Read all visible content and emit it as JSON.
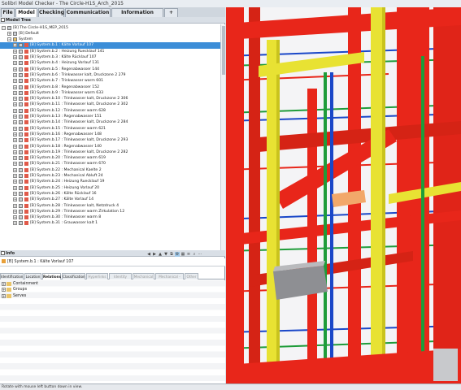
{
  "window": {
    "title": "Solibri Model Checker - The Circle-H1S_Arch_2015"
  },
  "menu": {
    "tabs": [
      {
        "label": "File"
      },
      {
        "label": "Model"
      },
      {
        "label": "Checking"
      },
      {
        "label": "Communication"
      },
      {
        "label": "Information Takeoff"
      },
      {
        "label": "+"
      }
    ],
    "active": "Model"
  },
  "model_tree": {
    "header": "Model Tree",
    "root": "[B] The Circle-H1S_MEP_2015",
    "default_node": "[B] Default",
    "system_node": "System",
    "items": [
      "[B] System.b.1 : Kälte Vorlauf 107",
      "[B] System.b.2 : Heizung Ruecklauf 141",
      "[B] System.b.3 : Kälte Rücklauf 107",
      "[B] System.b.4 : Heizung Vorlauf 131",
      "[B] System.b.5 : Regenabwasser 144",
      "[B] System.b.6 : Trinkwasser kalt, Druckzone 2 279",
      "[B] System.b.7 : Trinkwasser warm 601",
      "[B] System.b.8 : Regenabwasser 152",
      "[B] System.b.9 : Trinkwasser warm 633",
      "[B] System.b.10 : Trinkwasser kalt, Druckzone 2 306",
      "[B] System.b.11 : Trinkwasser kalt, Druckzone 2 302",
      "[B] System.b.12 : Trinkwasser warm 628",
      "[B] System.b.13 : Regenabwasser 151",
      "[B] System.b.14 : Trinkwasser kalt, Druckzone 2 284",
      "[B] System.b.15 : Trinkwasser warm 621",
      "[B] System.b.16 : Regenabwasser 148",
      "[B] System.b.17 : Trinkwasser kalt, Druckzone 2 293",
      "[B] System.b.18 : Regenabwasser 140",
      "[B] System.b.19 : Trinkwasser kalt, Druckzone 2 282",
      "[B] System.b.20 : Trinkwasser warm 619",
      "[B] System.b.21 : Trinkwasser warm 670",
      "[B] System.b.22 : Mechanical Kaelte 2",
      "[B] System.b.23 : Mechanical Abluft 24",
      "[B] System.b.24 : Heizung Ruecklauf 19",
      "[B] System.b.25 : Heizung Vorlauf 20",
      "[B] System.b.26 : Kälte Rücklauf 16",
      "[B] System.b.27 : Kälte Vorlauf 14",
      "[B] System.b.28 : Trinkwasser kalt, Netzdruck 4",
      "[B] System.b.29 : Trinkwasser warm Zirkulation 12",
      "[B] System.b.30 : Trinkwasser warm 8",
      "[B] System.b.31 : Grauwasser kalt 1"
    ],
    "selected_index": 0
  },
  "info": {
    "header": "Info",
    "selected_item": "[B] System.b.1 : Kälte Vorlauf 107",
    "tabs": [
      {
        "label": "Identification",
        "enabled": true
      },
      {
        "label": "Location",
        "enabled": true
      },
      {
        "label": "Relations",
        "enabled": true
      },
      {
        "label": "Classification",
        "enabled": true
      },
      {
        "label": "Hyperlinks",
        "enabled": false
      },
      {
        "label": "Identity Data",
        "enabled": false
      },
      {
        "label": "Mechanical",
        "enabled": false
      },
      {
        "label": "Mechanical - Flow",
        "enabled": false
      },
      {
        "label": "Other",
        "enabled": false
      }
    ],
    "active_tab": "Relations",
    "relations": [
      "Containment",
      "Groups",
      "Serves"
    ]
  },
  "status": {
    "text": "Rotate with mouse left button down in view."
  },
  "colors": {
    "selection": "#3c8ed8",
    "pipe_red": "#e8261a",
    "pipe_yellow": "#e8e233",
    "pipe_green": "#1f9c3a",
    "pipe_blue": "#1a47c8"
  },
  "icons": {
    "tree_item": "system-icon",
    "folder": "folder-icon",
    "pin": "pin-icon"
  }
}
